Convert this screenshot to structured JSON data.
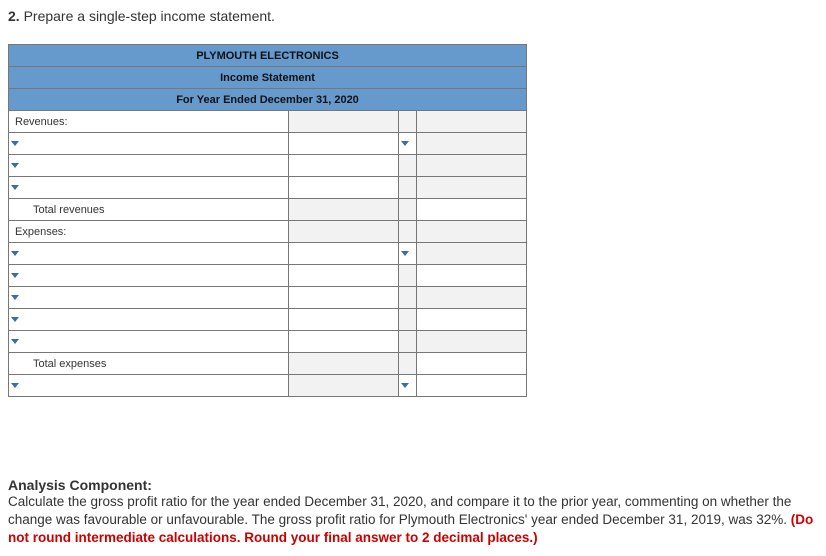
{
  "question": {
    "number": "2.",
    "text": "Prepare a single-step income statement."
  },
  "header": {
    "company": "PLYMOUTH ELECTRONICS",
    "title": "Income Statement",
    "period": "For Year Ended December 31, 2020"
  },
  "rows": {
    "revenues": "Revenues:",
    "total_revenues": "Total revenues",
    "expenses": "Expenses:",
    "total_expenses": "Total expenses"
  },
  "analysis": {
    "heading": "Analysis Component:",
    "body": "Calculate the gross profit ratio for the year ended December 31, 2020, and compare it to the prior year, commenting on whether the change was favourable or unfavourable. The gross profit ratio for Plymouth Electronics' year ended December 31, 2019, was 32%. ",
    "red": "(Do not round intermediate calculations. Round your final answer to 2 decimal places.)"
  }
}
